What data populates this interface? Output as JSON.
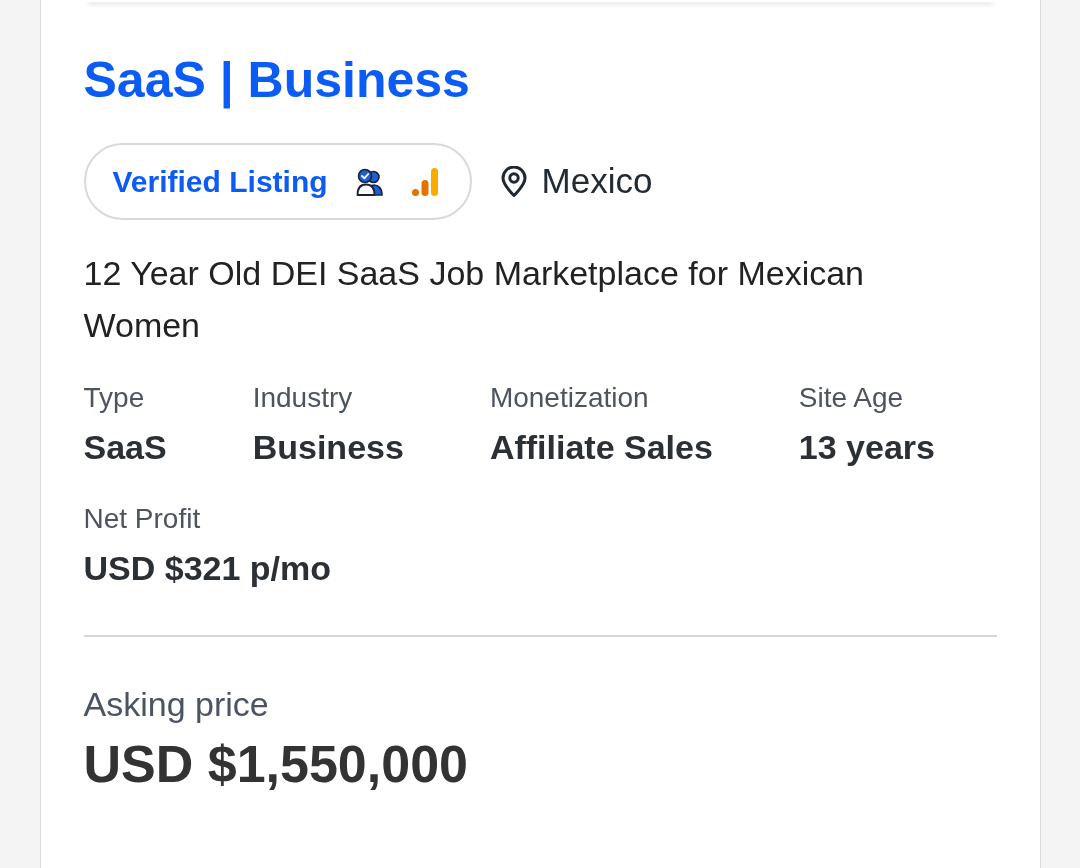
{
  "title": "SaaS | Business",
  "badge": {
    "label": "Verified Listing"
  },
  "location": "Mexico",
  "description": "12 Year Old DEI SaaS Job Marketplace for Mexican Women",
  "stats": [
    {
      "label": "Type",
      "value": "SaaS"
    },
    {
      "label": "Industry",
      "value": "Business"
    },
    {
      "label": "Monetization",
      "value": "Affiliate Sales"
    },
    {
      "label": "Site Age",
      "value": "13 years"
    },
    {
      "label": "Net Profit",
      "value": "USD $321 p/mo"
    }
  ],
  "asking_price": {
    "label": "Asking price",
    "value": "USD $1,550,000"
  }
}
